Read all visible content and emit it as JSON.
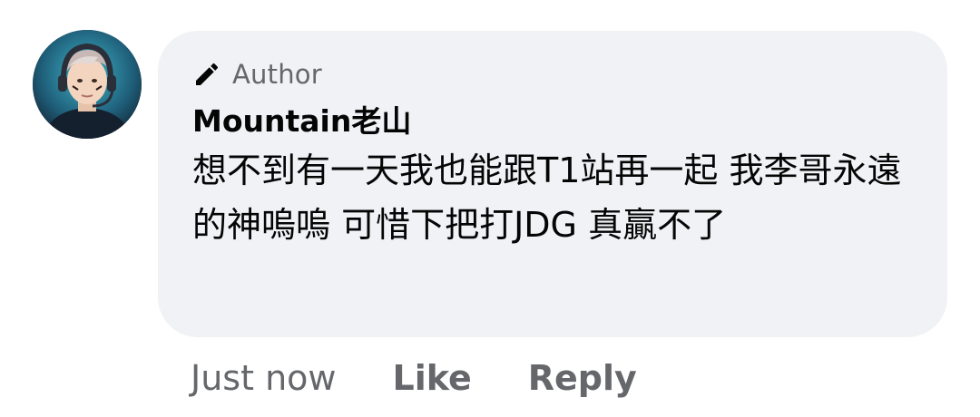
{
  "comment": {
    "author_badge": "Author",
    "name": "Mountain老山",
    "text": "想不到有一天我也能跟T1站再一起 我李哥永遠的神嗚嗚 可惜下把打JDG 真贏不了",
    "timestamp": "Just now",
    "like_label": "Like",
    "reply_label": "Reply"
  },
  "icons": {
    "badge_icon": "pencil-icon",
    "avatar": "profile-photo"
  },
  "colors": {
    "bubble_bg": "#f0f2f5",
    "secondary_text": "#65676b",
    "primary_text": "#050505"
  }
}
